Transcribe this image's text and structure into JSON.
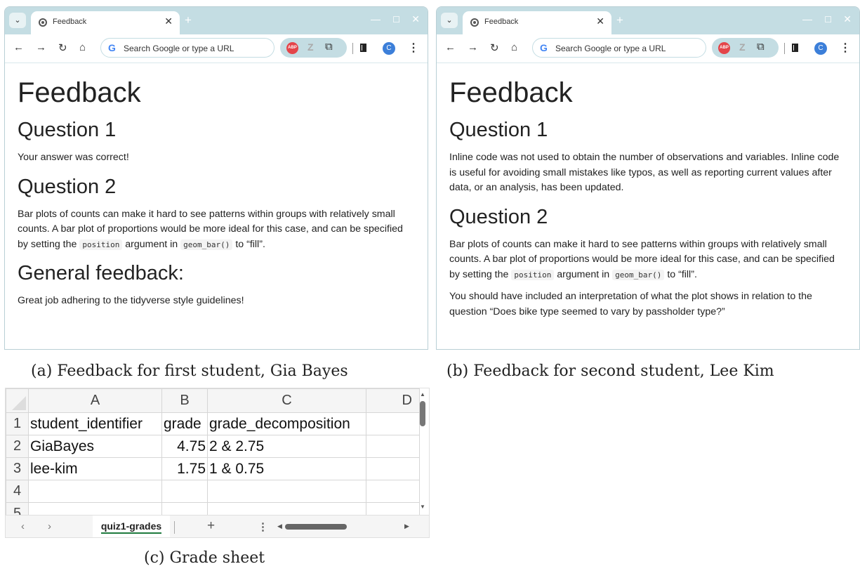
{
  "captions": {
    "a": "(a) Feedback for first student, Gia Bayes",
    "b": "(b) Feedback for second student, Lee Kim",
    "c": "(c) Grade sheet"
  },
  "browser": {
    "tab_title": "Feedback",
    "omnibox_placeholder": "Search Google or type a URL",
    "profile_initial": "C",
    "abp_label": "ABP",
    "z_label": "Z"
  },
  "window_a": {
    "h1": "Feedback",
    "q1_heading": "Question 1",
    "q1_text": "Your answer was correct!",
    "q2_heading": "Question 2",
    "q2_text_before": "Bar plots of counts can make it hard to see patterns within groups with relatively small counts. A bar plot of proportions would be more ideal for this case, and can be specified by setting the ",
    "q2_code1": "position",
    "q2_text_mid": " argument in ",
    "q2_code2": "geom_bar()",
    "q2_text_after": " to “fill”.",
    "general_heading": "General feedback:",
    "general_text": "Great job adhering to the tidyverse style guidelines!"
  },
  "window_b": {
    "h1": "Feedback",
    "q1_heading": "Question 1",
    "q1_text": "Inline code was not used to obtain the number of observations and variables. Inline code is useful for avoiding small mistakes like typos, as well as reporting current values after data, or an analysis, has been updated.",
    "q2_heading": "Question 2",
    "q2_text_before": "Bar plots of counts can make it hard to see patterns within groups with relatively small counts. A bar plot of proportions would be more ideal for this case, and can be specified by setting the ",
    "q2_code1": "position",
    "q2_text_mid": " argument in ",
    "q2_code2": "geom_bar()",
    "q2_text_after": " to “fill”.",
    "q2_text2": "You should have included an interpretation of what the plot shows in relation to the question “Does bike type seemed to vary by passholder type?”"
  },
  "sheet": {
    "columns": [
      "A",
      "B",
      "C",
      "D"
    ],
    "row_numbers": [
      "1",
      "2",
      "3",
      "4",
      "5"
    ],
    "rows": [
      [
        "student_identifier",
        "grade",
        "grade_decomposition",
        ""
      ],
      [
        "GiaBayes",
        "4.75",
        "2 & 2.75",
        ""
      ],
      [
        "lee-kim",
        "1.75",
        "1 & 0.75",
        ""
      ],
      [
        "",
        "",
        "",
        ""
      ]
    ],
    "tab_name": "quiz1-grades"
  }
}
